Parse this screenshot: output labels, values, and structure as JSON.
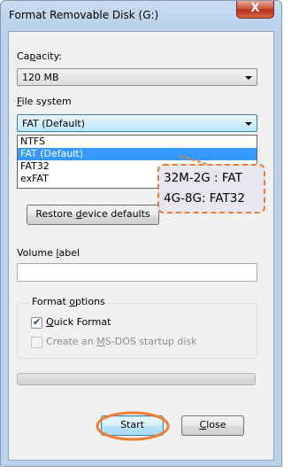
{
  "window": {
    "title": "Format Removable Disk (G:)",
    "close_glyph": "X"
  },
  "capacity": {
    "label": "Capacity:",
    "value": "120 MB"
  },
  "file_system": {
    "label": "File system",
    "value": "FAT (Default)",
    "options": [
      "NTFS",
      "FAT (Default)",
      "FAT32",
      "exFAT"
    ],
    "selected_index": 1
  },
  "restore_button": "Restore device defaults",
  "volume": {
    "label": "Volume label",
    "value": ""
  },
  "format_options": {
    "legend": "Format options",
    "quick_format": {
      "label": "Quick Format",
      "checked": true
    },
    "msdos": {
      "label": "Create an MS-DOS startup disk",
      "checked": false,
      "enabled": false
    }
  },
  "progress": {
    "value": 0
  },
  "buttons": {
    "start": "Start",
    "close": "Close"
  },
  "annotation": {
    "line1": "32M-2G : FAT",
    "line2": "4G-8G:  FAT32"
  },
  "colors": {
    "annotation_border": "#ed7d31",
    "annotation_fill": "#e7e6f1",
    "selection": "#3399ff"
  }
}
